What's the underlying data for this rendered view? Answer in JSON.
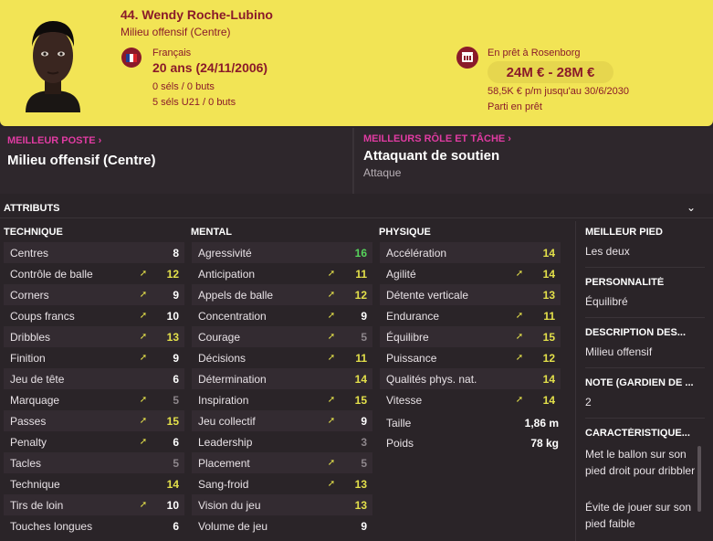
{
  "header": {
    "player_name": "44. Wendy Roche-Lubino",
    "position": "Milieu offensif (Centre)",
    "nationality": "Français",
    "age": "20 ans (24/11/2006)",
    "caps": "0 séls / 0 buts",
    "caps_u21": "5 séls U21 / 0 buts",
    "loan_text": "En prêt à Rosenborg",
    "value": "24M € - 28M €",
    "wage": "58,5K € p/m jusqu'au 30/6/2030",
    "leave_status": "Parti en prêt",
    "flag_colors": [
      "#1f3f95",
      "#ffffff",
      "#d8232a"
    ]
  },
  "best_position": {
    "title": "MEILLEUR POSTE",
    "value": "Milieu offensif (Centre)"
  },
  "best_role": {
    "title": "MEILLEURS RÔLE ET TÂCHE",
    "value": "Attaquant de soutien",
    "duty": "Attaque"
  },
  "attributes": {
    "title": "ATTRIBUTS",
    "technical": {
      "title": "TECHNIQUE",
      "rows": [
        {
          "name": "Centres",
          "value": "8",
          "arrow": false,
          "color": "white"
        },
        {
          "name": "Contrôle de balle",
          "value": "12",
          "arrow": true,
          "color": "yellow"
        },
        {
          "name": "Corners",
          "value": "9",
          "arrow": true,
          "color": "white"
        },
        {
          "name": "Coups francs",
          "value": "10",
          "arrow": true,
          "color": "white"
        },
        {
          "name": "Dribbles",
          "value": "13",
          "arrow": true,
          "color": "yellow"
        },
        {
          "name": "Finition",
          "value": "9",
          "arrow": true,
          "color": "white"
        },
        {
          "name": "Jeu de tête",
          "value": "6",
          "arrow": false,
          "color": "white"
        },
        {
          "name": "Marquage",
          "value": "5",
          "arrow": true,
          "color": "grey"
        },
        {
          "name": "Passes",
          "value": "15",
          "arrow": true,
          "color": "yellow"
        },
        {
          "name": "Penalty",
          "value": "6",
          "arrow": true,
          "color": "white"
        },
        {
          "name": "Tacles",
          "value": "5",
          "arrow": false,
          "color": "grey"
        },
        {
          "name": "Technique",
          "value": "14",
          "arrow": false,
          "color": "yellow"
        },
        {
          "name": "Tirs de loin",
          "value": "10",
          "arrow": true,
          "color": "white"
        },
        {
          "name": "Touches longues",
          "value": "6",
          "arrow": false,
          "color": "white"
        }
      ]
    },
    "mental": {
      "title": "MENTAL",
      "rows": [
        {
          "name": "Agressivité",
          "value": "16",
          "arrow": false,
          "color": "green"
        },
        {
          "name": "Anticipation",
          "value": "11",
          "arrow": true,
          "color": "yellow"
        },
        {
          "name": "Appels de balle",
          "value": "12",
          "arrow": true,
          "color": "yellow"
        },
        {
          "name": "Concentration",
          "value": "9",
          "arrow": true,
          "color": "white"
        },
        {
          "name": "Courage",
          "value": "5",
          "arrow": true,
          "color": "grey"
        },
        {
          "name": "Décisions",
          "value": "11",
          "arrow": true,
          "color": "yellow"
        },
        {
          "name": "Détermination",
          "value": "14",
          "arrow": false,
          "color": "yellow"
        },
        {
          "name": "Inspiration",
          "value": "15",
          "arrow": true,
          "color": "yellow"
        },
        {
          "name": "Jeu collectif",
          "value": "9",
          "arrow": true,
          "color": "white"
        },
        {
          "name": "Leadership",
          "value": "3",
          "arrow": false,
          "color": "grey"
        },
        {
          "name": "Placement",
          "value": "5",
          "arrow": true,
          "color": "grey"
        },
        {
          "name": "Sang-froid",
          "value": "13",
          "arrow": true,
          "color": "yellow"
        },
        {
          "name": "Vision du jeu",
          "value": "13",
          "arrow": false,
          "color": "yellow"
        },
        {
          "name": "Volume de jeu",
          "value": "9",
          "arrow": false,
          "color": "white"
        }
      ]
    },
    "physical": {
      "title": "PHYSIQUE",
      "rows": [
        {
          "name": "Accélération",
          "value": "14",
          "arrow": false,
          "color": "yellow"
        },
        {
          "name": "Agilité",
          "value": "14",
          "arrow": true,
          "color": "yellow"
        },
        {
          "name": "Détente verticale",
          "value": "13",
          "arrow": false,
          "color": "yellow"
        },
        {
          "name": "Endurance",
          "value": "11",
          "arrow": true,
          "color": "yellow"
        },
        {
          "name": "Équilibre",
          "value": "15",
          "arrow": true,
          "color": "yellow"
        },
        {
          "name": "Puissance",
          "value": "12",
          "arrow": true,
          "color": "yellow"
        },
        {
          "name": "Qualités phys. nat.",
          "value": "14",
          "arrow": false,
          "color": "yellow"
        },
        {
          "name": "Vitesse",
          "value": "14",
          "arrow": true,
          "color": "yellow"
        }
      ],
      "height_label": "Taille",
      "height_value": "1,86 m",
      "weight_label": "Poids",
      "weight_value": "78 kg"
    }
  },
  "info": {
    "best_foot_title": "MEILLEUR PIED",
    "best_foot_value": "Les deux",
    "personality_title": "PERSONNALITÉ",
    "personality_value": "Équilibré",
    "description_title": "DESCRIPTION DES...",
    "description_value": "Milieu offensif",
    "note_title": "NOTE (GARDIEN DE ...",
    "note_value": "2",
    "traits_title": "CARACTÉRISTIQUE...",
    "trait_1": "Met le ballon sur son pied droit pour dribbler",
    "trait_2": "Évite de jouer sur son pied faible"
  },
  "colors": {
    "header_bg": "#f2e455",
    "header_text": "#8a1a2a",
    "accent_pink": "#e03ba2",
    "good_green": "#56d35b",
    "highlight_yellow": "#e3e04a"
  }
}
